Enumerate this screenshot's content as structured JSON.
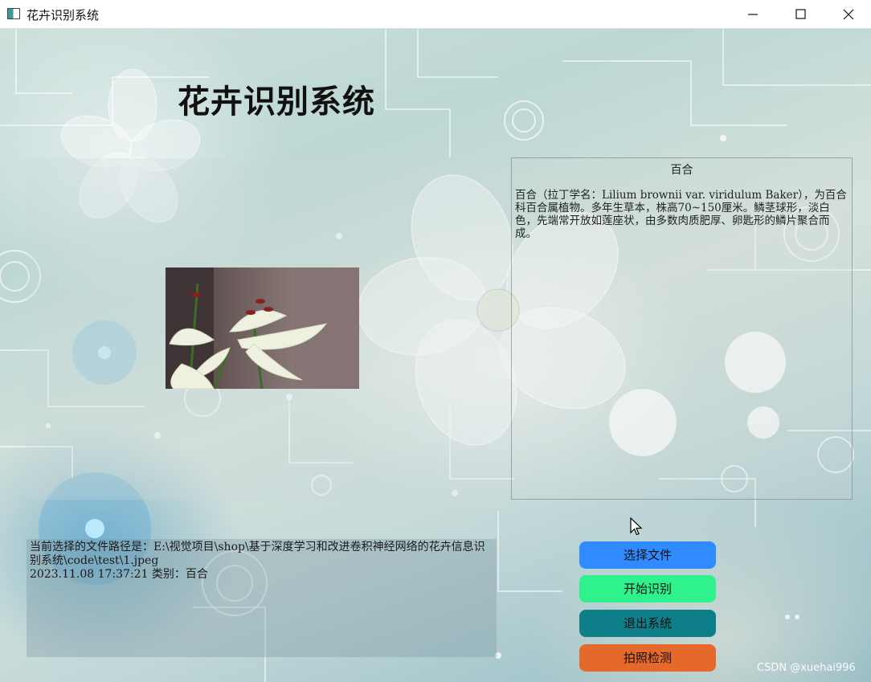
{
  "window": {
    "title": "花卉识别系统",
    "controls": {
      "minimize": "minimize-icon",
      "maximize": "maximize-icon",
      "close": "close-icon"
    }
  },
  "header": {
    "title": "花卉识别系统"
  },
  "result": {
    "flower_name": "百合",
    "description": "百合（拉丁学名：Lilium brownii var. viridulum Baker），为百合科百合属植物。多年生草本，株高70~150厘米。鳞茎球形，淡白色，先端常开放如莲座状，由多数肉质肥厚、卵匙形的鳞片聚合而成。"
  },
  "status": {
    "line1": "当前选择的文件路径是：E:\\视觉项目\\shop\\基于深度学习和改进卷积神经网络的花卉信息识别系统\\code\\test\\1.jpeg",
    "line2": "2023.11.08 17:37:21 类别：百合"
  },
  "buttons": {
    "select_file": "选择文件",
    "start_recognition": "开始识别",
    "exit_system": "退出系统",
    "photo_detect": "拍照检测"
  },
  "watermark": "CSDN @xuehai996",
  "colors": {
    "select_file": "#2f8bff",
    "start_recognition": "#2ff28c",
    "exit_system": "#0e7f88",
    "photo_detect": "#e4692a"
  }
}
